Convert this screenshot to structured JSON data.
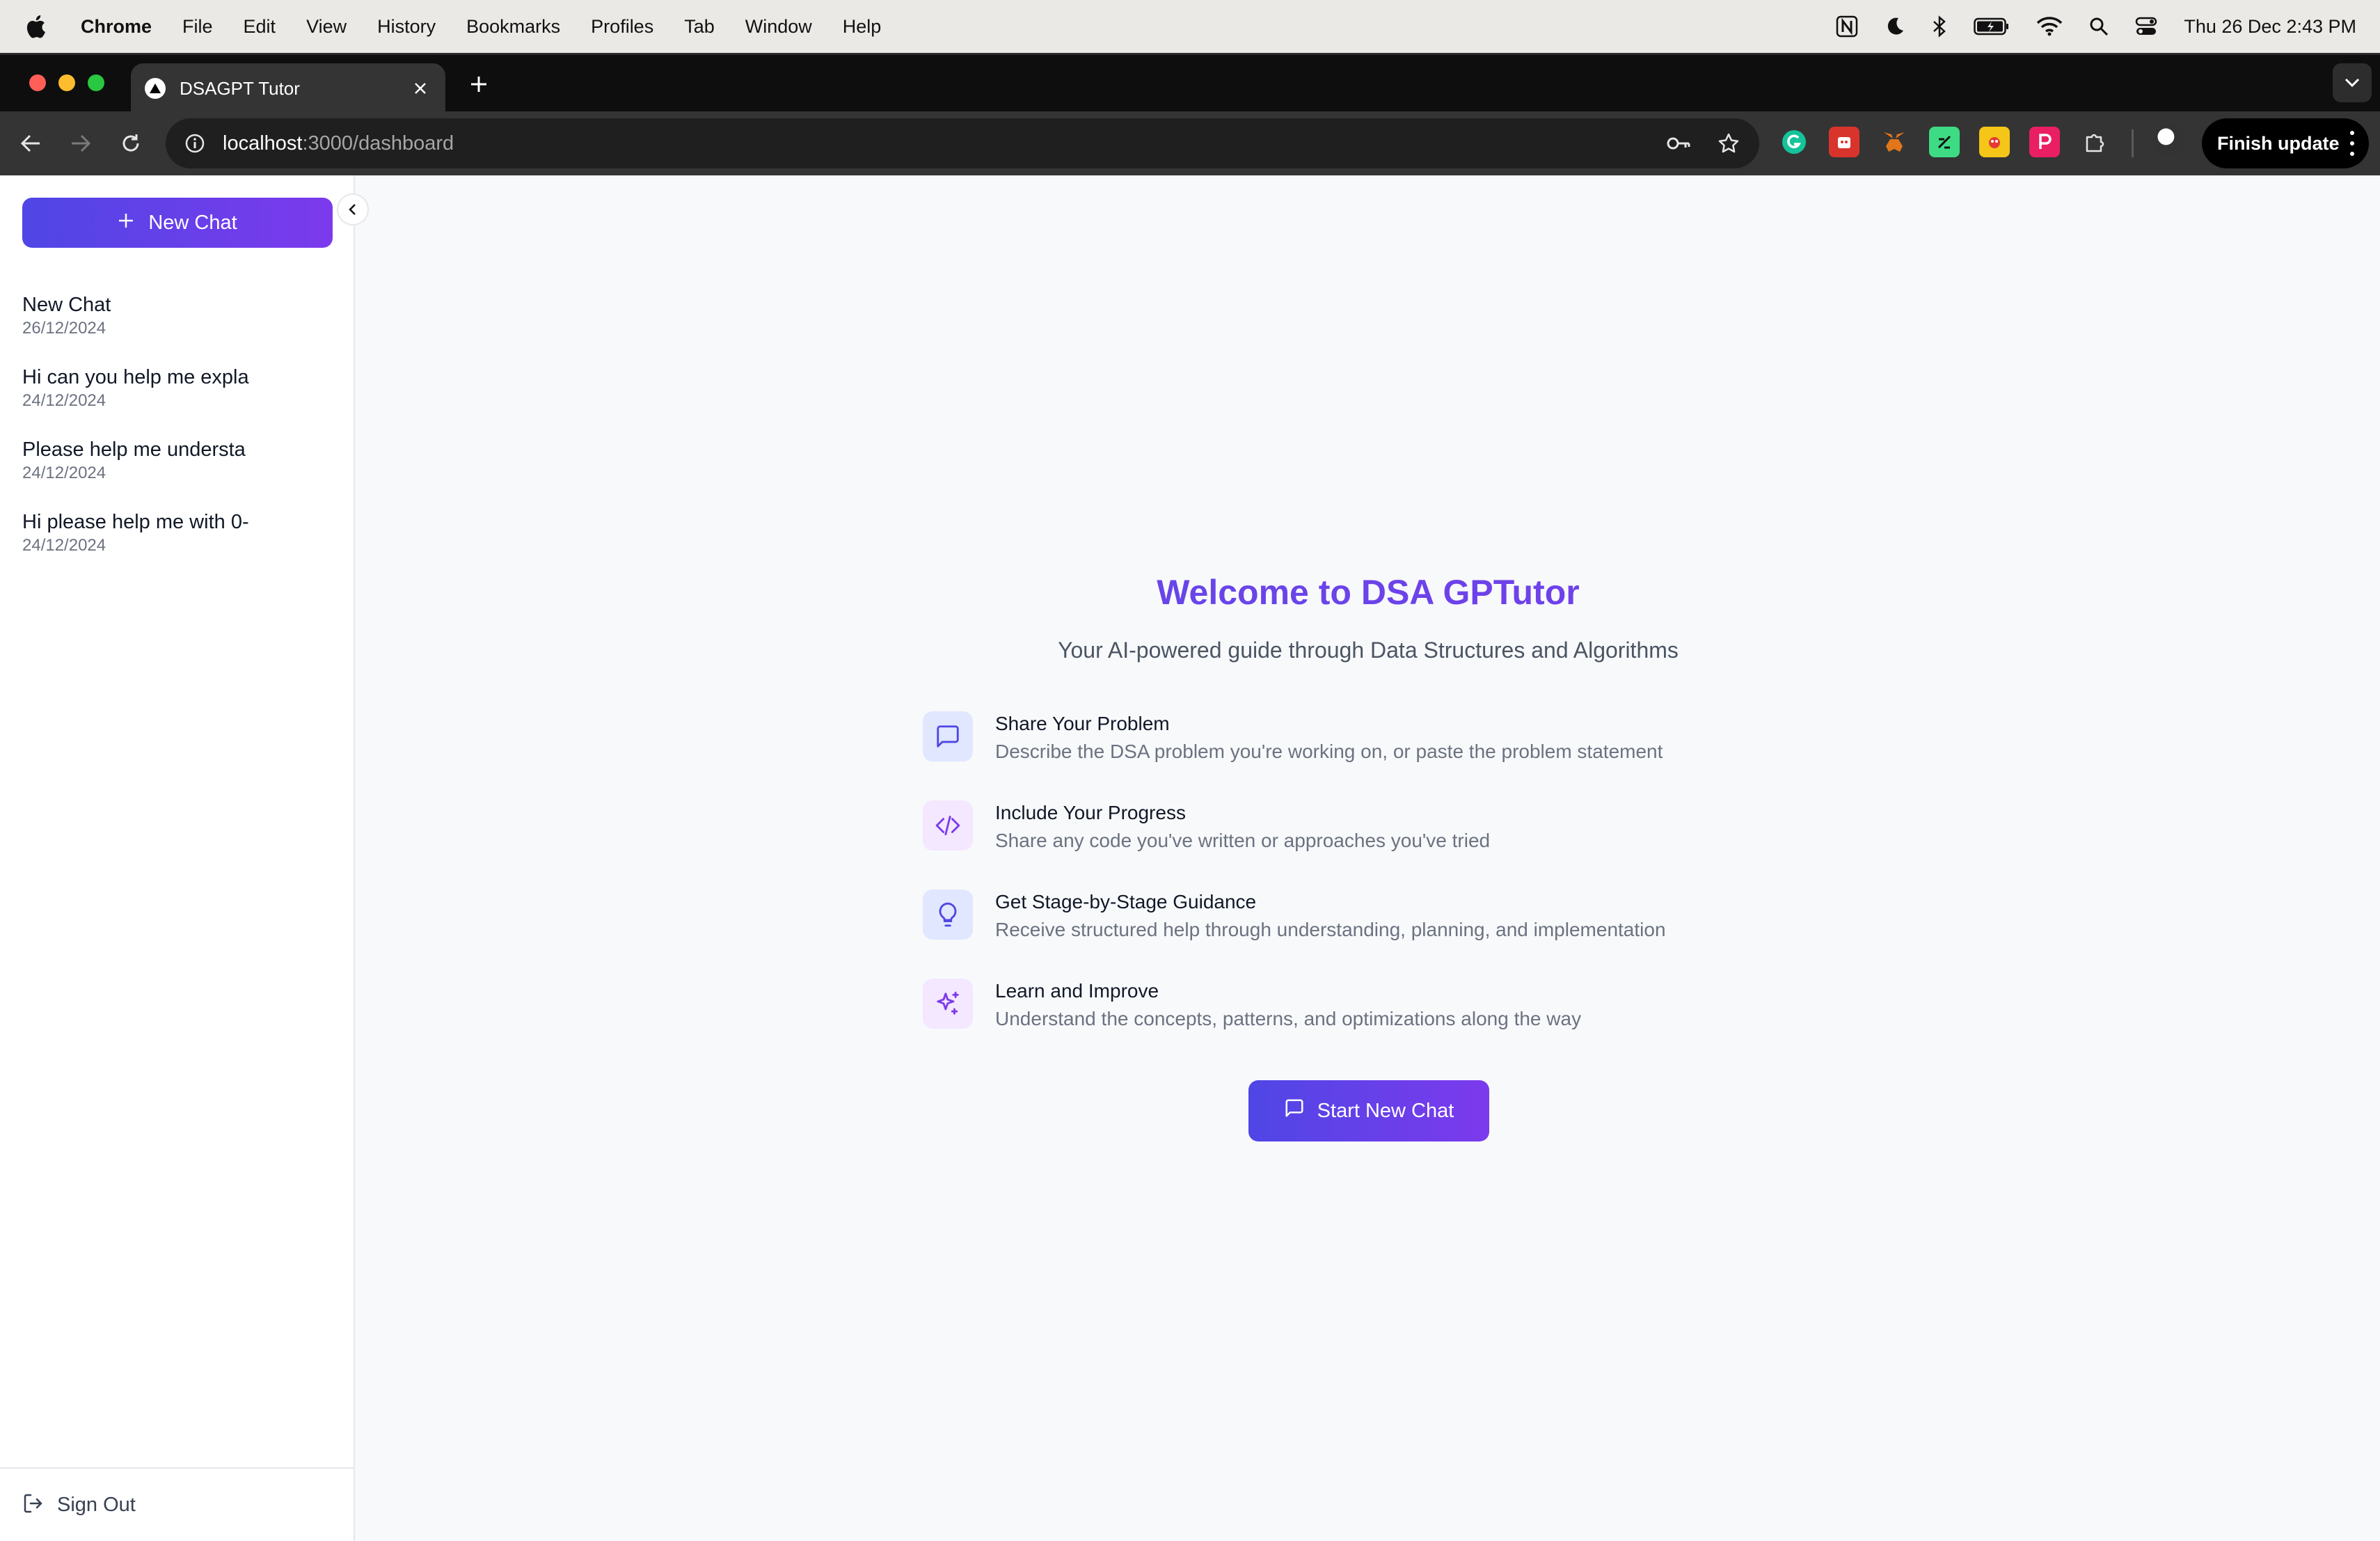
{
  "menubar": {
    "app": "Chrome",
    "items": [
      "File",
      "Edit",
      "View",
      "History",
      "Bookmarks",
      "Profiles",
      "Tab",
      "Window",
      "Help"
    ],
    "clock": "Thu 26 Dec  2:43 PM",
    "status_icons": [
      "notion-icon",
      "moon-icon",
      "bluetooth-icon",
      "battery-icon",
      "wifi-icon",
      "spotlight-icon",
      "control-center-icon"
    ]
  },
  "browser": {
    "tab_title": "DSAGPT Tutor",
    "url_host": "localhost",
    "url_path": ":3000/dashboard",
    "finish_update": "Finish update",
    "extensions": [
      "grammarly-icon",
      "extension-red-icon",
      "metamask-icon",
      "extension-green-icon",
      "extension-yellow-icon",
      "extension-pink-icon",
      "puzzle-icon"
    ]
  },
  "sidebar": {
    "new_chat": "New Chat",
    "chats": [
      {
        "title": "New Chat",
        "date": "26/12/2024"
      },
      {
        "title": "Hi can you help me expla",
        "date": "24/12/2024"
      },
      {
        "title": "Please help me understa",
        "date": "24/12/2024"
      },
      {
        "title": "Hi please help me with 0-",
        "date": "24/12/2024"
      }
    ],
    "sign_out": "Sign Out"
  },
  "main": {
    "title": "Welcome to DSA GPTutor",
    "subtitle": "Your AI-powered guide through Data Structures and Algorithms",
    "features": [
      {
        "title": "Share Your Problem",
        "desc": "Describe the DSA problem you're working on, or paste the problem statement",
        "icon": "message-square-icon"
      },
      {
        "title": "Include Your Progress",
        "desc": "Share any code you've written or approaches you've tried",
        "icon": "code-icon"
      },
      {
        "title": "Get Stage-by-Stage Guidance",
        "desc": "Receive structured help through understanding, planning, and implementation",
        "icon": "lightbulb-icon"
      },
      {
        "title": "Learn and Improve",
        "desc": "Understand the concepts, patterns, and optimizations along the way",
        "icon": "sparkles-icon"
      }
    ],
    "start_button": "Start New Chat"
  },
  "colors": {
    "accent_start": "#4f46e5",
    "accent_end": "#7c3aed",
    "menubar_bg": "#ebe9e6",
    "chrome_toolbar": "#343434"
  }
}
